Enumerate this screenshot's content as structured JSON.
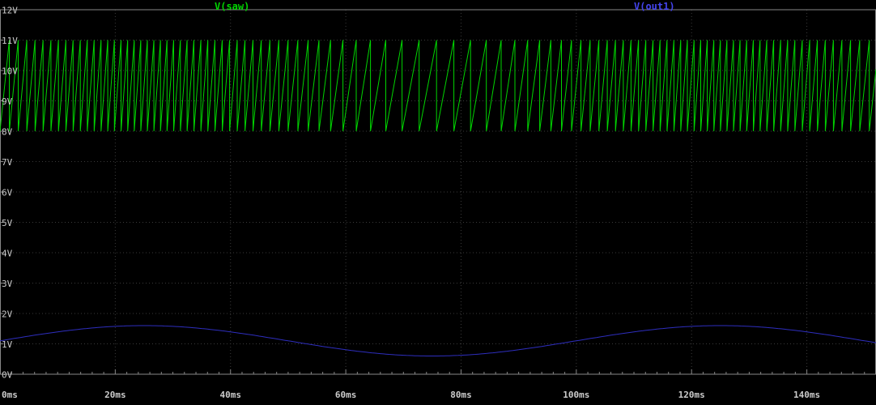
{
  "colors": {
    "background": "#000000",
    "grid": "#3a3a3a",
    "border": "#878787",
    "tick_text": "#cccccc",
    "saw_trace": "#00d400",
    "sine_trace": "#2e2ebe",
    "saw_label": "#00d400",
    "sine_label": "#4444ee"
  },
  "chart_data": {
    "type": "line",
    "title": "",
    "xlabel": "",
    "ylabel": "",
    "x_axis": {
      "unit": "ms",
      "min": 0,
      "max": 152,
      "major_tick_step_ms": 20,
      "minor_tick_step_ms": 2,
      "tick_labels": [
        "0ms",
        "20ms",
        "40ms",
        "60ms",
        "80ms",
        "100ms",
        "120ms",
        "140ms"
      ]
    },
    "y_axis": {
      "unit": "V",
      "min": 0,
      "max": 12,
      "tick_step_v": 1,
      "tick_labels": [
        "0V",
        "1V",
        "2V",
        "3V",
        "4V",
        "5V",
        "6V",
        "7V",
        "8V",
        "9V",
        "10V",
        "11V",
        "12V"
      ]
    },
    "grid": "dotted",
    "legend_position": "top-inside",
    "series": [
      {
        "name": "V(saw)",
        "kind": "sawtooth_vco",
        "v_min": 8,
        "v_max": 11,
        "vco_gain_hz_per_volt": 550,
        "control_series": "V(out1)"
      },
      {
        "name": "V(out1)",
        "kind": "sine",
        "offset_v": 1.1,
        "amplitude_v": 0.5,
        "period_ms": 100,
        "phase_deg": 0
      }
    ]
  }
}
